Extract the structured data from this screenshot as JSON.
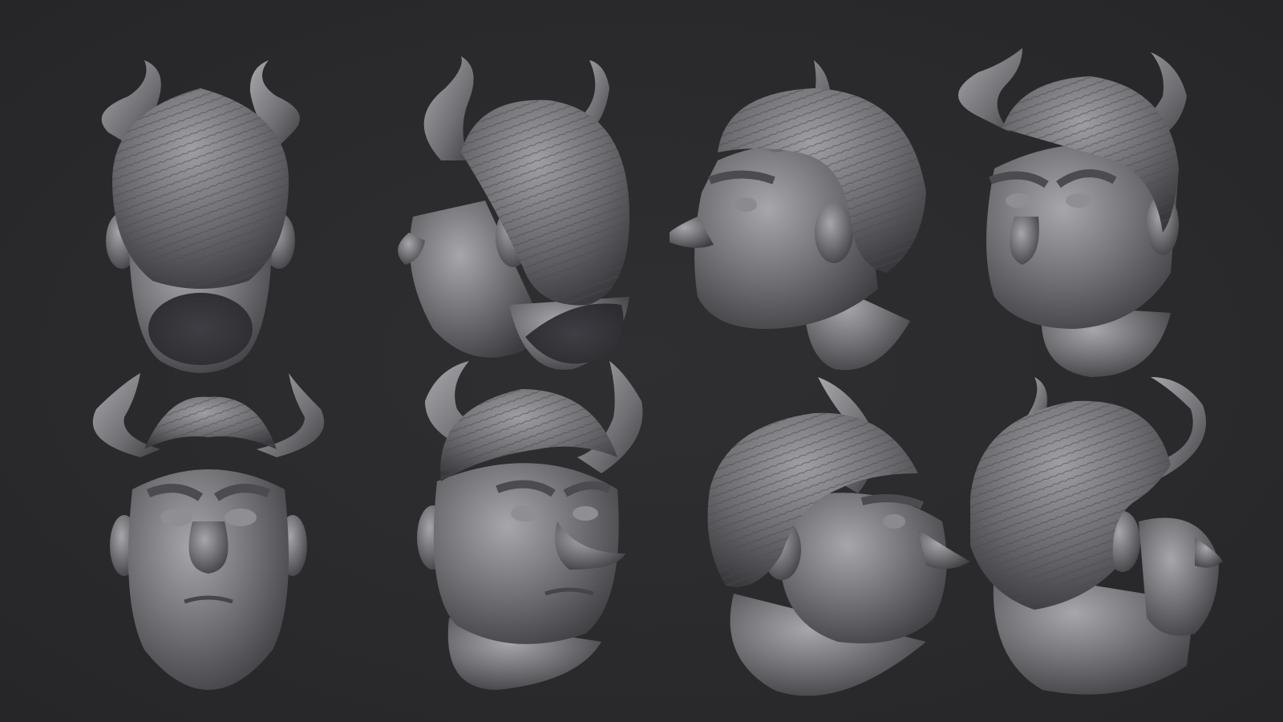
{
  "scene": {
    "background_color": "#2a2a2c",
    "clay_color": "#6b6b70",
    "clay_highlight": "#a4a4a9",
    "clay_shadow": "#38383c",
    "views": [
      {
        "id": "back-view",
        "row": 1,
        "col": 1
      },
      {
        "id": "rear-three-quarter-view",
        "row": 1,
        "col": 2
      },
      {
        "id": "left-profile-view",
        "row": 1,
        "col": 3
      },
      {
        "id": "front-three-quarter-left-view",
        "row": 1,
        "col": 4
      },
      {
        "id": "front-view",
        "row": 2,
        "col": 1
      },
      {
        "id": "front-three-quarter-right-view",
        "row": 2,
        "col": 2
      },
      {
        "id": "right-profile-view",
        "row": 2,
        "col": 3
      },
      {
        "id": "rear-three-quarter-right-view",
        "row": 2,
        "col": 4
      }
    ]
  }
}
